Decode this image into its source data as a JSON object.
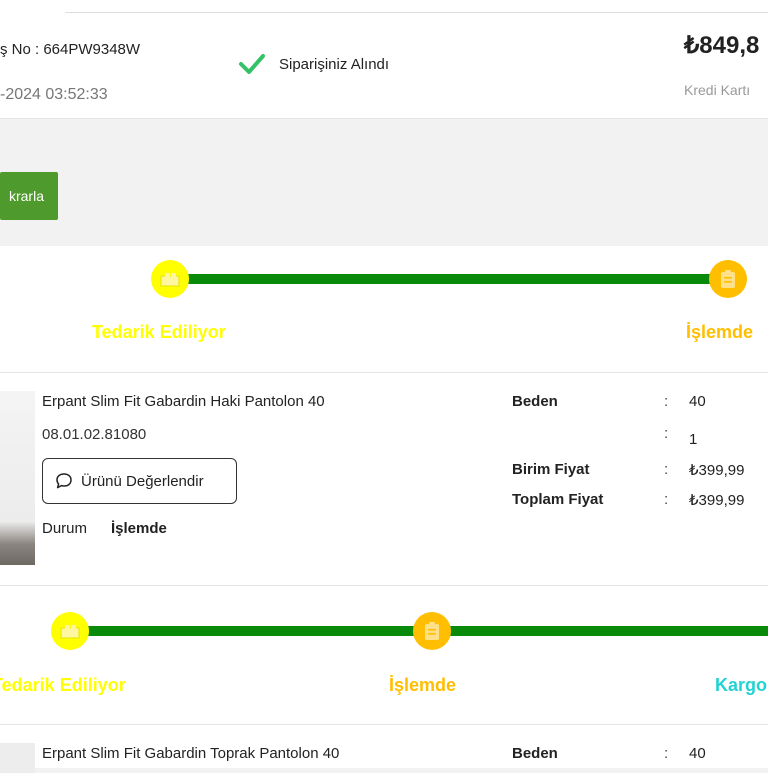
{
  "order": {
    "number_label": "ş No : 664PW9348W",
    "date": "-2024 03:52:33",
    "status": "Siparişiniz Alındı",
    "total": "₺849,8",
    "payment": "Kredi Kartı"
  },
  "repeat_button": "krarla",
  "tracker1": {
    "steps": [
      "Tedarik Ediliyor",
      "İşlemde"
    ],
    "colors": {
      "supply": "#ffff00",
      "processing": "#ffbf00",
      "line": "#0a8a0a"
    }
  },
  "product1": {
    "name": "Erpant Slim Fit Gabardin Haki Pantolon 40",
    "code": "08.01.02.81080",
    "rate_button": "Ürünü Değerlendir",
    "status_label": "Durum",
    "status_value": "İşlemde",
    "specs": [
      {
        "label": "Beden",
        "value": "40"
      },
      {
        "label": "",
        "value": "1"
      },
      {
        "label": "Birim Fiyat",
        "value": "₺399,99"
      },
      {
        "label": "Toplam Fiyat",
        "value": "₺399,99"
      }
    ]
  },
  "tracker2": {
    "steps": [
      "Tedarik Ediliyor",
      "İşlemde",
      "Kargo"
    ],
    "colors": {
      "supply": "#ffff00",
      "processing": "#ffbf00",
      "cargo": "#22d3d3"
    }
  },
  "product2": {
    "name": "Erpant Slim Fit Gabardin Toprak Pantolon 40",
    "specs": [
      {
        "label": "Beden",
        "value": "40"
      }
    ]
  }
}
